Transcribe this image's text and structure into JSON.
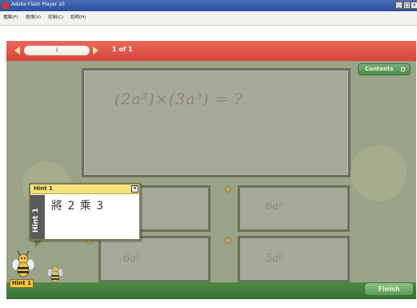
{
  "window": {
    "title": "Adobe Flash Player 10"
  },
  "menubar": {
    "items": [
      "檔案(F)",
      "檢視(V)",
      "控制(C)",
      "說明(H)"
    ]
  },
  "navbar": {
    "page_input_value": "1",
    "page_counter": "1 of 1"
  },
  "contents_button": {
    "label": "Contents"
  },
  "question": {
    "text": "(2a²)×(3a³) = ?"
  },
  "answers": [
    {
      "text": ""
    },
    {
      "text": "6a²"
    },
    {
      "text": "6a²"
    },
    {
      "text": "5a⁶"
    }
  ],
  "hint": {
    "header_label": "Hint 1",
    "side_label": "Hint 1",
    "close_glyph": "✕",
    "text": "將 2 乘 3",
    "bottom_label": "Hint 1"
  },
  "finish_button": {
    "label": "Finish"
  },
  "colors": {
    "nav_red": "#d6453a",
    "flash_bg": "#9aa287",
    "hint_yellow": "#f5e27a",
    "finish_green": "#5b9a55"
  },
  "icons": {
    "app": "flash-player-icon",
    "prev": "triangle-left-icon",
    "next": "triangle-right-icon",
    "close": "close-icon",
    "contents": "list-icon"
  }
}
